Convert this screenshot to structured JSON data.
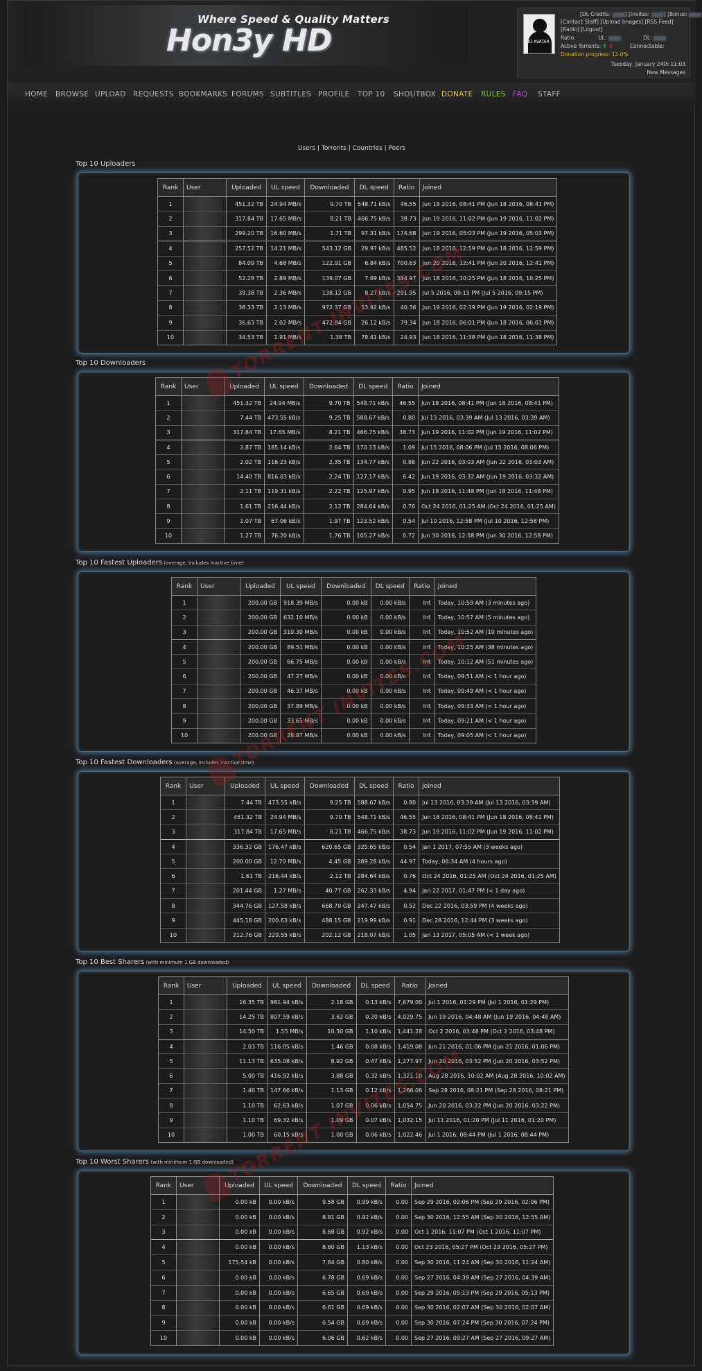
{
  "header": {
    "tagline": "Where Speed & Quality Matters",
    "logo": "Hon3y HD",
    "avatar_text": "NO AVATAR",
    "dl_credits_label": "[DL Credits:",
    "invites_label": "] [Invites:",
    "bonus_label": "] [Bonus:",
    "links1": "[Contact Staff] [Upload Images] [RSS Feed]",
    "links2": "[Radio] [Logout]",
    "ratio_label": "Ratio:",
    "ul_label": "UL:",
    "dl_label": "DL:",
    "active_label": "Active Torrents:",
    "connectable_label": "Connectable:",
    "donation": "Donation progress: 12.0%",
    "date": "Tuesday, January 24th 11:03",
    "new_messages": "New Messages"
  },
  "nav": [
    {
      "label": "HOME",
      "color": "#b8b8b8"
    },
    {
      "label": "BROWSE",
      "color": "#b8b8b8"
    },
    {
      "label": "UPLOAD",
      "color": "#b8b8b8"
    },
    {
      "label": "REQUESTS",
      "color": "#b8b8b8"
    },
    {
      "label": "BOOKMARKS",
      "color": "#b8b8b8"
    },
    {
      "label": "FORUMS",
      "color": "#b8b8b8"
    },
    {
      "label": "SUBTITLES",
      "color": "#b8b8b8"
    },
    {
      "label": "PROFILE",
      "color": "#b8b8b8"
    },
    {
      "label": "TOP 10",
      "color": "#b8b8b8"
    },
    {
      "label": "SHOUTBOX",
      "color": "#b8b8b8"
    },
    {
      "label": "DONATE",
      "color": "#e8c23a"
    },
    {
      "label": "RULES",
      "color": "#7fcf3a"
    },
    {
      "label": "FAQ",
      "color": "#b24fd6"
    },
    {
      "label": "STAFF",
      "color": "#b8b8b8"
    }
  ],
  "subnav": {
    "users": "Users",
    "torrents": "Torrents",
    "countries": "Countries",
    "peers": "Peers",
    "sep": " | "
  },
  "watermark": "TORRENT INVITES.COM",
  "headers": {
    "rank": "Rank",
    "user": "User",
    "uploaded": "Uploaded",
    "ul_speed": "UL speed",
    "downloaded": "Downloaded",
    "dl_speed": "DL speed",
    "ratio": "Ratio",
    "joined": "Joined"
  },
  "sections": [
    {
      "title": "Top 10 Uploaders",
      "subtitle": "",
      "rows": [
        [
          "1",
          "451.32 TB",
          "24.94 MB/s",
          "9.70 TB",
          "548.71 kB/s",
          "46.55",
          "Jun 18 2016, 08:41 PM (Jun 18 2016, 08:41 PM)"
        ],
        [
          "2",
          "317.84 TB",
          "17.65 MB/s",
          "8.21 TB",
          "466.75 kB/s",
          "38.73",
          "Jun 19 2016, 11:02 PM (Jun 19 2016, 11:02 PM)"
        ],
        [
          "3",
          "299.20 TB",
          "16.60 MB/s",
          "1.71 TB",
          "97.31 kB/s",
          "174.68",
          "Jun 19 2016, 05:03 PM (Jun 19 2016, 05:03 PM)"
        ],
        [
          "4",
          "257.52 TB",
          "14.21 MB/s",
          "543.12 GB",
          "29.97 kB/s",
          "485.52",
          "Jun 18 2016, 12:59 PM (Jun 18 2016, 12:59 PM)"
        ],
        [
          "5",
          "84.09 TB",
          "4.68 MB/s",
          "122.91 GB",
          "6.84 kB/s",
          "700.63",
          "Jun 20 2016, 12:41 PM (Jun 20 2016, 12:41 PM)"
        ],
        [
          "6",
          "52.28 TB",
          "2.89 MB/s",
          "139.07 GB",
          "7.69 kB/s",
          "384.97",
          "Jun 18 2016, 10:25 PM (Jun 18 2016, 10:25 PM)"
        ],
        [
          "7",
          "39.38 TB",
          "2.36 MB/s",
          "138.12 GB",
          "8.27 kB/s",
          "291.95",
          "Jul 5 2016, 09:15 PM (Jul 5 2016, 09:15 PM)"
        ],
        [
          "8",
          "38.33 TB",
          "2.13 MB/s",
          "972.37 GB",
          "53.92 kB/s",
          "40.36",
          "Jun 19 2016, 02:19 PM (Jun 19 2016, 02:19 PM)"
        ],
        [
          "9",
          "36.63 TB",
          "2.02 MB/s",
          "472.84 GB",
          "26.12 kB/s",
          "79.34",
          "Jun 18 2016, 06:01 PM (Jun 18 2016, 06:01 PM)"
        ],
        [
          "10",
          "34.53 TB",
          "1.91 MB/s",
          "1.38 TB",
          "78.41 kB/s",
          "24.93",
          "Jun 18 2016, 11:38 PM (Jun 18 2016, 11:38 PM)"
        ]
      ]
    },
    {
      "title": "Top 10 Downloaders",
      "subtitle": "",
      "rows": [
        [
          "1",
          "451.32 TB",
          "24.94 MB/s",
          "9.70 TB",
          "548.71 kB/s",
          "46.55",
          "Jun 18 2016, 08:41 PM (Jun 18 2016, 08:41 PM)"
        ],
        [
          "2",
          "7.44 TB",
          "473.55 kB/s",
          "9.25 TB",
          "588.67 kB/s",
          "0.80",
          "Jul 13 2016, 03:39 AM (Jul 13 2016, 03:39 AM)"
        ],
        [
          "3",
          "317.84 TB",
          "17.65 MB/s",
          "8.21 TB",
          "466.75 kB/s",
          "38.73",
          "Jun 19 2016, 11:02 PM (Jun 19 2016, 11:02 PM)"
        ],
        [
          "4",
          "2.87 TB",
          "185.14 kB/s",
          "2.64 TB",
          "170.13 kB/s",
          "1.09",
          "Jul 15 2016, 08:06 PM (Jul 15 2016, 08:06 PM)"
        ],
        [
          "5",
          "2.02 TB",
          "116.23 kB/s",
          "2.35 TB",
          "134.77 kB/s",
          "0.86",
          "Jun 22 2016, 03:03 AM (Jun 22 2016, 03:03 AM)"
        ],
        [
          "6",
          "14.40 TB",
          "816.03 kB/s",
          "2.24 TB",
          "127.17 kB/s",
          "6.42",
          "Jun 19 2016, 03:32 AM (Jun 19 2016, 03:32 AM)"
        ],
        [
          "7",
          "2.11 TB",
          "119.31 kB/s",
          "2.22 TB",
          "125.97 kB/s",
          "0.95",
          "Jun 18 2016, 11:48 PM (Jun 18 2016, 11:48 PM)"
        ],
        [
          "8",
          "1.61 TB",
          "216.44 kB/s",
          "2.12 TB",
          "284.64 kB/s",
          "0.76",
          "Oct 24 2016, 01:25 AM (Oct 24 2016, 01:25 AM)"
        ],
        [
          "9",
          "1.07 TB",
          "67.06 kB/s",
          "1.97 TB",
          "123.52 kB/s",
          "0.54",
          "Jul 10 2016, 12:58 PM (Jul 10 2016, 12:58 PM)"
        ],
        [
          "10",
          "1.27 TB",
          "76.20 kB/s",
          "1.76 TB",
          "105.27 kB/s",
          "0.72",
          "Jun 30 2016, 12:58 PM (Jun 30 2016, 12:58 PM)"
        ]
      ]
    },
    {
      "title": "Top 10 Fastest Uploaders",
      "subtitle": "(average, includes inactive time)",
      "rows": [
        [
          "1",
          "200.00 GB",
          "918.39 MB/s",
          "0.00 kB",
          "0.00 kB/s",
          "Inf.",
          "Today, 10:59 AM (3 minutes ago)"
        ],
        [
          "2",
          "200.00 GB",
          "632.10 MB/s",
          "0.00 kB",
          "0.00 kB/s",
          "Inf.",
          "Today, 10:57 AM (5 minutes ago)"
        ],
        [
          "3",
          "200.00 GB",
          "310.30 MB/s",
          "0.00 kB",
          "0.00 kB/s",
          "Inf.",
          "Today, 10:52 AM (10 minutes ago)"
        ],
        [
          "4",
          "200.00 GB",
          "89.51 MB/s",
          "0.00 kB",
          "0.00 kB/s",
          "Inf.",
          "Today, 10:25 AM (38 minutes ago)"
        ],
        [
          "5",
          "200.00 GB",
          "66.75 MB/s",
          "0.00 kB",
          "0.00 kB/s",
          "Inf.",
          "Today, 10:12 AM (51 minutes ago)"
        ],
        [
          "6",
          "200.00 GB",
          "47.27 MB/s",
          "0.00 kB",
          "0.00 kB/s",
          "Inf.",
          "Today, 09:51 AM (< 1 hour ago)"
        ],
        [
          "7",
          "200.00 GB",
          "46.37 MB/s",
          "0.00 kB",
          "0.00 kB/s",
          "Inf.",
          "Today, 09:49 AM (< 1 hour ago)"
        ],
        [
          "8",
          "200.00 GB",
          "37.89 MB/s",
          "0.00 kB",
          "0.00 kB/s",
          "Inf.",
          "Today, 09:33 AM (< 1 hour ago)"
        ],
        [
          "9",
          "200.00 GB",
          "33.65 MB/s",
          "0.00 kB",
          "0.00 kB/s",
          "Inf.",
          "Today, 09:21 AM (< 1 hour ago)"
        ],
        [
          "10",
          "200.00 GB",
          "28.87 MB/s",
          "0.00 kB",
          "0.00 kB/s",
          "Inf.",
          "Today, 09:05 AM (< 1 hour ago)"
        ]
      ]
    },
    {
      "title": "Top 10 Fastest Downloaders",
      "subtitle": "(average, includes inactive time)",
      "rows": [
        [
          "1",
          "7.44 TB",
          "473.55 kB/s",
          "9.25 TB",
          "588.67 kB/s",
          "0.80",
          "Jul 13 2016, 03:39 AM (Jul 13 2016, 03:39 AM)"
        ],
        [
          "2",
          "451.32 TB",
          "24.94 MB/s",
          "9.70 TB",
          "548.71 kB/s",
          "46.55",
          "Jun 18 2016, 08:41 PM (Jun 18 2016, 08:41 PM)"
        ],
        [
          "3",
          "317.84 TB",
          "17.65 MB/s",
          "8.21 TB",
          "466.75 kB/s",
          "38.73",
          "Jun 19 2016, 11:02 PM (Jun 19 2016, 11:02 PM)"
        ],
        [
          "4",
          "336.32 GB",
          "176.47 kB/s",
          "620.65 GB",
          "325.65 kB/s",
          "0.54",
          "Jan 1 2017, 07:55 AM (3 weeks ago)"
        ],
        [
          "5",
          "200.00 GB",
          "12.70 MB/s",
          "4.45 GB",
          "289.28 kB/s",
          "44.97",
          "Today, 06:34 AM (4 hours ago)"
        ],
        [
          "6",
          "1.61 TB",
          "216.44 kB/s",
          "2.12 TB",
          "284.64 kB/s",
          "0.76",
          "Oct 24 2016, 01:25 AM (Oct 24 2016, 01:25 AM)"
        ],
        [
          "7",
          "201.44 GB",
          "1.27 MB/s",
          "40.77 GB",
          "262.33 kB/s",
          "4.94",
          "Jan 22 2017, 01:47 PM (< 1 day ago)"
        ],
        [
          "8",
          "344.76 GB",
          "127.58 kB/s",
          "668.70 GB",
          "247.47 kB/s",
          "0.52",
          "Dec 22 2016, 03:59 PM (4 weeks ago)"
        ],
        [
          "9",
          "445.18 GB",
          "200.63 kB/s",
          "488.15 GB",
          "219.99 kB/s",
          "0.91",
          "Dec 28 2016, 12:44 PM (3 weeks ago)"
        ],
        [
          "10",
          "212.76 GB",
          "229.55 kB/s",
          "202.12 GB",
          "218.07 kB/s",
          "1.05",
          "Jan 13 2017, 05:05 AM (< 1 week ago)"
        ]
      ]
    },
    {
      "title": "Top 10 Best Sharers",
      "subtitle": "(with minimum 1 GB downloaded)",
      "rows": [
        [
          "1",
          "16.35 TB",
          "981.94 kB/s",
          "2.18 GB",
          "0.13 kB/s",
          "7,679.00",
          "Jul 1 2016, 01:29 PM (Jul 1 2016, 01:29 PM)"
        ],
        [
          "2",
          "14.25 TB",
          "807.59 kB/s",
          "3.62 GB",
          "0.20 kB/s",
          "4,029.75",
          "Jun 19 2016, 04:48 AM (Jun 19 2016, 04:48 AM)"
        ],
        [
          "3",
          "14.50 TB",
          "1.55 MB/s",
          "10.30 GB",
          "1.10 kB/s",
          "1,441.28",
          "Oct 2 2016, 03:48 PM (Oct 2 2016, 03:48 PM)"
        ],
        [
          "4",
          "2.03 TB",
          "116.05 kB/s",
          "1.46 GB",
          "0.08 kB/s",
          "1,419.08",
          "Jun 21 2016, 01:06 PM (Jun 21 2016, 01:06 PM)"
        ],
        [
          "5",
          "11.13 TB",
          "635.08 kB/s",
          "8.92 GB",
          "0.47 kB/s",
          "1,277.97",
          "Jun 20 2016, 03:52 PM (Jun 20 2016, 03:52 PM)"
        ],
        [
          "6",
          "5.00 TB",
          "416.92 kB/s",
          "3.88 GB",
          "0.32 kB/s",
          "1,321.10",
          "Aug 28 2016, 10:02 AM (Aug 28 2016, 10:02 AM)"
        ],
        [
          "7",
          "1.40 TB",
          "147.66 kB/s",
          "1.13 GB",
          "0.12 kB/s",
          "1,266.06",
          "Sep 28 2016, 08:21 PM (Sep 28 2016, 08:21 PM)"
        ],
        [
          "8",
          "1.10 TB",
          "62.63 kB/s",
          "1.07 GB",
          "0.06 kB/s",
          "1,054.75",
          "Jun 20 2016, 03:22 PM (Jun 20 2016, 03:22 PM)"
        ],
        [
          "9",
          "1.10 TB",
          "69.32 kB/s",
          "1.09 GB",
          "0.07 kB/s",
          "1,032.15",
          "Jul 11 2016, 01:20 PM (Jul 11 2016, 01:20 PM)"
        ],
        [
          "10",
          "1.00 TB",
          "60.15 kB/s",
          "1.00 GB",
          "0.06 kB/s",
          "1,022.46",
          "Jul 1 2016, 08:44 PM (Jul 1 2016, 08:44 PM)"
        ]
      ]
    },
    {
      "title": "Top 10 Worst Sharers",
      "subtitle": "(with minimum 1 GB downloaded)",
      "rows": [
        [
          "1",
          "0.00 kB",
          "0.00 kB/s",
          "9.58 GB",
          "0.99 kB/s",
          "0.00",
          "Sep 29 2016, 02:06 PM (Sep 29 2016, 02:06 PM)"
        ],
        [
          "2",
          "0.00 kB",
          "0.00 kB/s",
          "8.81 GB",
          "0.92 kB/s",
          "0.00",
          "Sep 30 2016, 12:55 AM (Sep 30 2016, 12:55 AM)"
        ],
        [
          "3",
          "0.00 kB",
          "0.00 kB/s",
          "8.68 GB",
          "0.92 kB/s",
          "0.00",
          "Oct 1 2016, 11:07 PM (Oct 1 2016, 11:07 PM)"
        ],
        [
          "4",
          "0.00 kB",
          "0.00 kB/s",
          "8.60 GB",
          "1.13 kB/s",
          "0.00",
          "Oct 23 2016, 05:27 PM (Oct 23 2016, 05:27 PM)"
        ],
        [
          "5",
          "175.54 kB",
          "0.00 kB/s",
          "7.64 GB",
          "0.80 kB/s",
          "0.00",
          "Sep 30 2016, 11:24 AM (Sep 30 2016, 11:24 AM)"
        ],
        [
          "6",
          "0.00 kB",
          "0.00 kB/s",
          "6.78 GB",
          "0.69 kB/s",
          "0.00",
          "Sep 27 2016, 04:39 AM (Sep 27 2016, 04:39 AM)"
        ],
        [
          "7",
          "0.00 kB",
          "0.00 kB/s",
          "6.65 GB",
          "0.69 kB/s",
          "0.00",
          "Sep 29 2016, 05:13 PM (Sep 29 2016, 05:13 PM)"
        ],
        [
          "8",
          "0.00 kB",
          "0.00 kB/s",
          "6.61 GB",
          "0.69 kB/s",
          "0.00",
          "Sep 30 2016, 02:07 AM (Sep 30 2016, 02:07 AM)"
        ],
        [
          "9",
          "0.00 kB",
          "0.00 kB/s",
          "6.54 GB",
          "0.69 kB/s",
          "0.00",
          "Sep 30 2016, 07:24 PM (Sep 30 2016, 07:24 PM)"
        ],
        [
          "10",
          "0.00 kB",
          "0.00 kB/s",
          "6.06 GB",
          "0.62 kB/s",
          "0.00",
          "Sep 27 2016, 09:27 AM (Sep 27 2016, 09:27 AM)"
        ]
      ]
    }
  ]
}
